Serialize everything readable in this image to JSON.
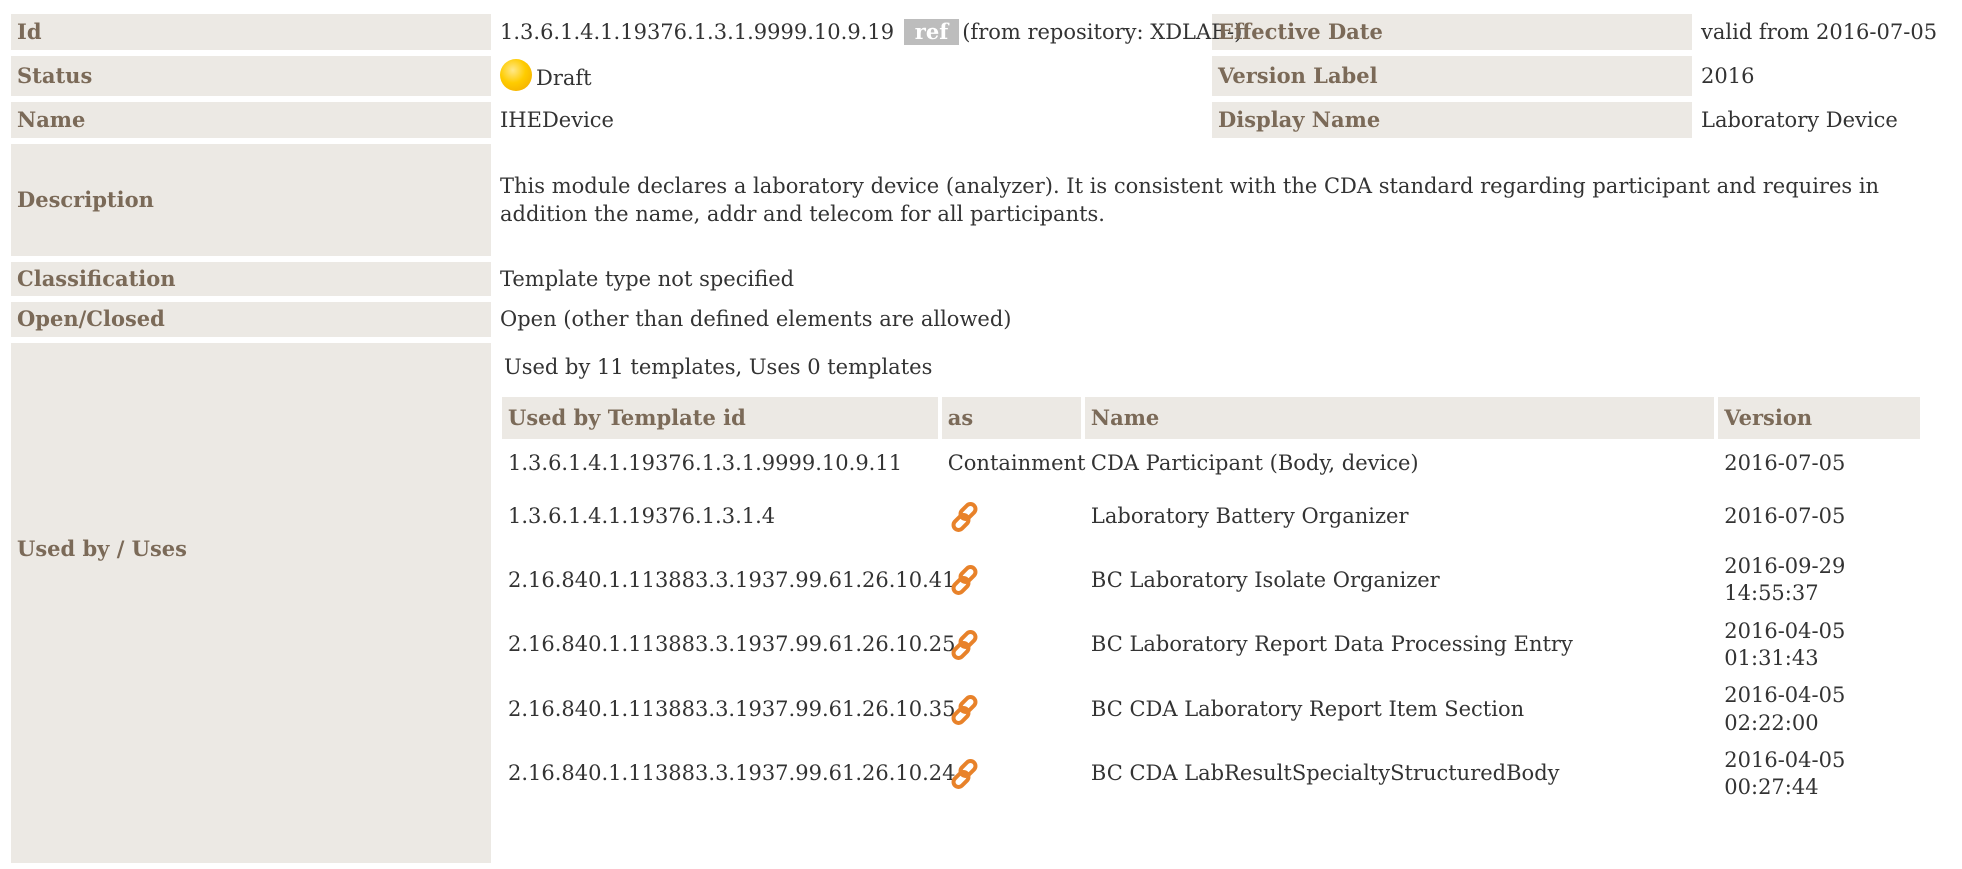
{
  "id": {
    "label": "Id",
    "value": "1.3.6.1.4.1.19376.1.3.1.9999.10.9.19",
    "badge": "ref",
    "repository": "(from repository: XDLAB-)"
  },
  "effective_date": {
    "label": "Effective Date",
    "value": "valid from 2016-07-05"
  },
  "status": {
    "label": "Status",
    "value": "Draft",
    "icon": "status-draft-icon",
    "color": "#ffcc00"
  },
  "version_label": {
    "label": "Version Label",
    "value": "2016"
  },
  "name": {
    "label": "Name",
    "value": "IHEDevice"
  },
  "display_name": {
    "label": "Display Name",
    "value": "Laboratory Device"
  },
  "description": {
    "label": "Description",
    "value": "This module declares a laboratory device (analyzer). It is consistent with the CDA standard regarding participant and requires in addition the name, addr and telecom for all participants."
  },
  "classification": {
    "label": "Classification",
    "value": "Template type not specified"
  },
  "open_closed": {
    "label": "Open/Closed",
    "value": "Open (other than defined elements are allowed)"
  },
  "used_by": {
    "label": "Used by / Uses",
    "summary": "Used by 11 templates, Uses 0 templates",
    "columns": [
      "Used by Template id",
      "as",
      "Name",
      "Version"
    ],
    "rows": [
      {
        "id": "1.3.6.1.4.1.19376.1.3.1.9999.10.9.11",
        "as": "Containment",
        "name": "CDA Participant (Body, device)",
        "version": "2016-07-05"
      },
      {
        "id": "1.3.6.1.4.1.19376.1.3.1.4",
        "as": "link-icon",
        "name": "Laboratory Battery Organizer",
        "version": "2016-07-05"
      },
      {
        "id": "2.16.840.1.113883.3.1937.99.61.26.10.41",
        "as": "link-icon",
        "name": "BC Laboratory Isolate Organizer",
        "version": "2016-09-29 14:55:37"
      },
      {
        "id": "2.16.840.1.113883.3.1937.99.61.26.10.25",
        "as": "link-icon",
        "name": "BC Laboratory Report Data Processing Entry",
        "version": "2016-04-05 01:31:43"
      },
      {
        "id": "2.16.840.1.113883.3.1937.99.61.26.10.35",
        "as": "link-icon",
        "name": "BC CDA Laboratory Report Item Section",
        "version": "2016-04-05 02:22:00"
      },
      {
        "id": "2.16.840.1.113883.3.1937.99.61.26.10.24",
        "as": "link-icon",
        "name": "BC CDA LabResultSpecialtyStructuredBody",
        "version": "2016-04-05 00:27:44"
      }
    ]
  },
  "colors": {
    "label_bg": "#ece9e4",
    "label_text": "#7b6a58",
    "link_icon": "#e8822a",
    "badge_bg": "#bdbdbd"
  }
}
